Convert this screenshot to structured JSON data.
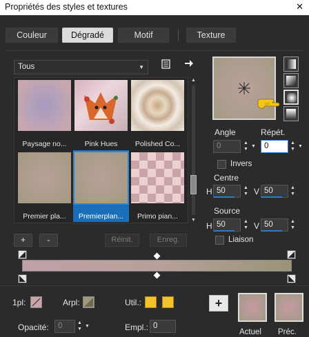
{
  "window": {
    "title": "Propriétés des styles et textures",
    "close": "✕"
  },
  "tabs": [
    "Couleur",
    "Dégradé",
    "Motif",
    "Texture"
  ],
  "category": {
    "selected": "Tous"
  },
  "gradients": [
    {
      "name": "Paysage no..."
    },
    {
      "name": "Pink Hues"
    },
    {
      "name": "Polished Co..."
    },
    {
      "name": "Premier pla..."
    },
    {
      "name": "Premierplan...",
      "selected": true
    },
    {
      "name": "Primo pian..."
    }
  ],
  "grid_buttons": {
    "add": "+",
    "remove": "-",
    "reset": "Réinit.",
    "save": "Enreg."
  },
  "angle": {
    "label": "Angle",
    "value": "0"
  },
  "repeat": {
    "label": "Répét.",
    "value": "0"
  },
  "invert": {
    "label": "Invers",
    "checked": false
  },
  "center": {
    "label": "Centre",
    "h_label": "H",
    "h_value": "50",
    "v_label": "V",
    "v_value": "50"
  },
  "source": {
    "label": "Source",
    "h_label": "H",
    "h_value": "50",
    "v_label": "V",
    "v_value": "50"
  },
  "link": {
    "label": "Liaison",
    "checked": false
  },
  "bottom": {
    "fg_label": "1pl:",
    "bg_label": "Arpl:",
    "util_label": "Util.:",
    "opacity_label": "Opacité:",
    "opacity_value": "0",
    "location_label": "Empl.:",
    "location_value": "0",
    "current_label": "Actuel",
    "previous_label": "Préc.",
    "add_label": "+"
  },
  "colors": {
    "accent": "#2a7bd0",
    "gradient_start": "#c0a1a6",
    "gradient_end": "#9a9478",
    "util_yellow": "#f2c12e"
  }
}
